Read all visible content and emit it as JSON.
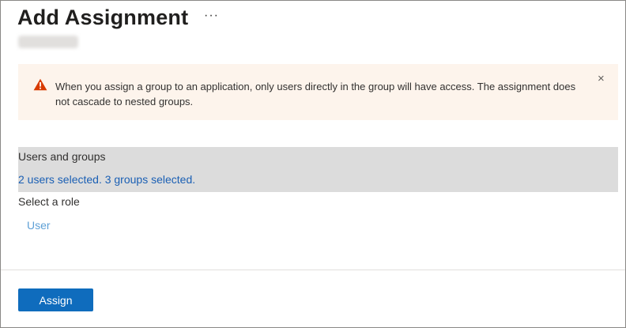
{
  "header": {
    "title": "Add Assignment",
    "more_label": "···"
  },
  "banner": {
    "icon": "warning-icon",
    "message": "When you assign a group to an application, only users directly in the group will have access. The assignment does not cascade to nested groups.",
    "close_label": "×",
    "color": "#fdf4ec",
    "icon_color": "#d83b01"
  },
  "users_and_groups": {
    "label": "Users and groups",
    "selection": "2 users selected. 3 groups selected."
  },
  "role": {
    "label": "Select a role",
    "value": "User"
  },
  "footer": {
    "assign_label": "Assign",
    "accent": "#0f6cbd"
  }
}
